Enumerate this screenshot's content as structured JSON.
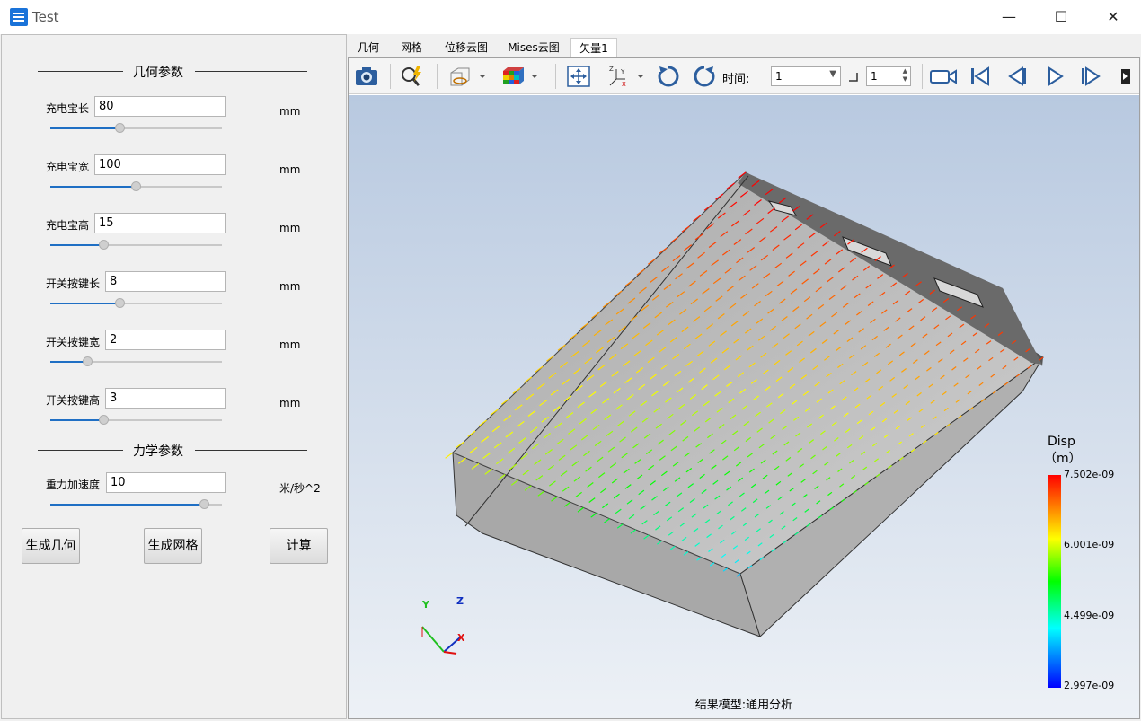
{
  "window": {
    "title": "Test",
    "controls": [
      "—",
      "☐",
      "✕"
    ]
  },
  "geometry_group": {
    "title": "几何参数"
  },
  "params": [
    {
      "label": "充电宝长",
      "value": "80",
      "unit": "mm",
      "fraction": 0.4
    },
    {
      "label": "充电宝宽",
      "value": "100",
      "unit": "mm",
      "fraction": 0.5
    },
    {
      "label": "充电宝高",
      "value": "15",
      "unit": "mm",
      "fraction": 0.3
    },
    {
      "label": "开关按键长",
      "value": "8",
      "unit": "mm",
      "fraction": 0.4
    },
    {
      "label": "开关按键宽",
      "value": "2",
      "unit": "mm",
      "fraction": 0.2
    },
    {
      "label": "开关按键高",
      "value": "3",
      "unit": "mm",
      "fraction": 0.3
    }
  ],
  "mechanics_group": {
    "title": "力学参数"
  },
  "gravity": {
    "label": "重力加速度",
    "value": "10",
    "unit": "米/秒^2",
    "fraction": 0.92
  },
  "buttons": {
    "gen_geometry": "生成几何",
    "gen_mesh": "生成网格",
    "compute": "计算"
  },
  "tabs": [
    {
      "label": "几何"
    },
    {
      "label": "网格"
    },
    {
      "label": "位移云图"
    },
    {
      "label": "Mises云图"
    },
    {
      "label": "矢量1",
      "active": true
    }
  ],
  "toolbar": {
    "icons": [
      "camera-icon",
      "zoom-fit-icon",
      "view-cube-icon",
      "color-cube-icon",
      "pan-icon",
      "axis-icon",
      "rotate-cw-icon",
      "rotate-ccw-icon",
      "video-icon",
      "first-frame-icon",
      "prev-frame-icon",
      "play-icon",
      "next-frame-icon"
    ],
    "time_label": "时间:",
    "time_value": "1",
    "step_value": "1"
  },
  "legend": {
    "title": "Disp",
    "unit": "（m）",
    "values": [
      "7.502e-09",
      "6.001e-09",
      "4.499e-09",
      "2.997e-09"
    ],
    "colors": [
      "#ff0000",
      "#ffff00",
      "#00ff00",
      "#00ffff",
      "#0000ff"
    ]
  },
  "axes": {
    "x": "X",
    "y": "Y",
    "z": "Z"
  },
  "footer": "结果模型:通用分析"
}
